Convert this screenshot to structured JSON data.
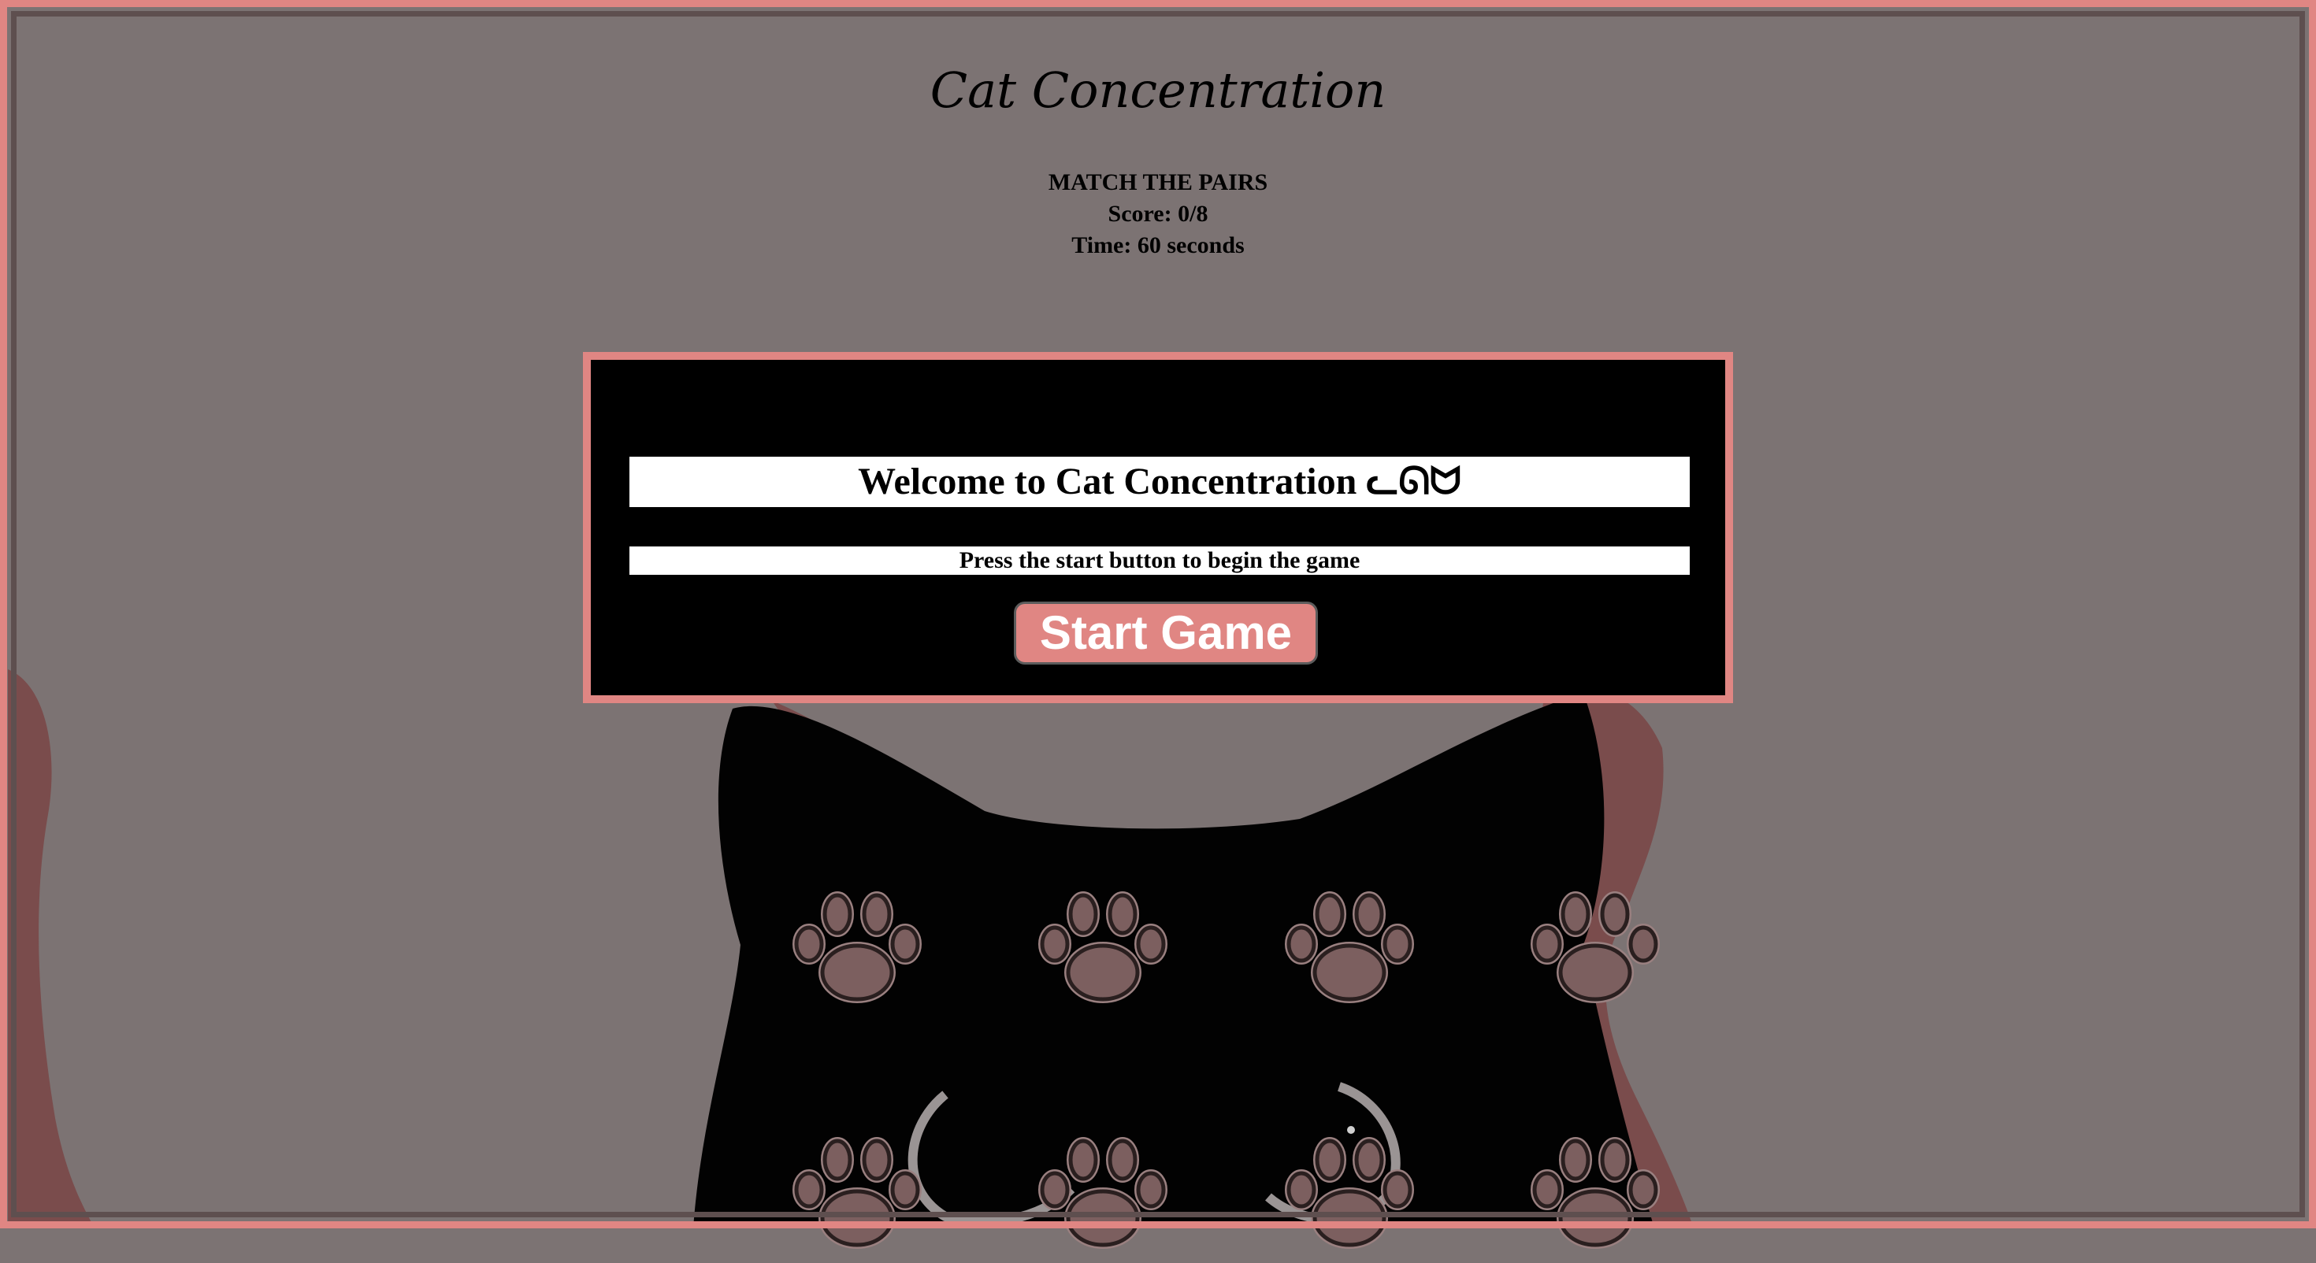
{
  "game": {
    "title": "Cat Concentration",
    "mode_label": "MATCH THE PAIRS",
    "score": "Score: 0/8",
    "time": "Time: 60 seconds"
  },
  "modal": {
    "welcome": "Welcome to Cat Concentration ᓚᘏᗢ",
    "instructions": "Press the start button to begin the game",
    "start_label": "Start Game"
  },
  "cards": [
    {
      "state": "face-down",
      "icon": "paw-icon"
    },
    {
      "state": "face-down",
      "icon": "paw-icon"
    },
    {
      "state": "face-down",
      "icon": "paw-icon"
    },
    {
      "state": "face-down",
      "icon": "paw-icon"
    },
    {
      "state": "face-down",
      "icon": "paw-icon"
    },
    {
      "state": "face-down",
      "icon": "paw-icon"
    },
    {
      "state": "face-down",
      "icon": "paw-icon"
    },
    {
      "state": "face-down",
      "icon": "paw-icon"
    },
    {
      "state": "face-down",
      "icon": "paw-icon"
    },
    {
      "state": "face-down",
      "icon": "paw-icon"
    },
    {
      "state": "face-down",
      "icon": "paw-icon"
    },
    {
      "state": "face-down",
      "icon": "paw-icon"
    }
  ],
  "colors": {
    "accent": "#e08683",
    "background": "#7c7373",
    "paw_fill": "#7c5f5f",
    "paw_outline": "#2a1f1f",
    "modal_bg": "#000000"
  }
}
